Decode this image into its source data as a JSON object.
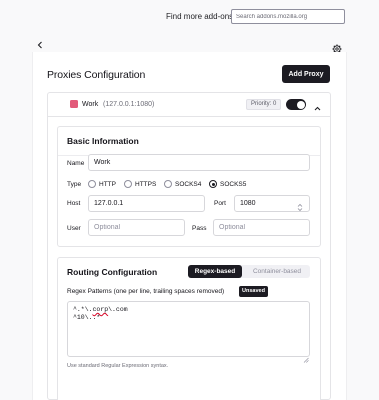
{
  "header": {
    "find_label": "Find more add-ons",
    "search_placeholder": "Search addons.mozilla.org"
  },
  "toolbar": {
    "back_icon": "chevron-left-icon",
    "settings_icon": "gear-icon"
  },
  "main": {
    "title": "Proxies Configuration",
    "add_proxy_label": "Add Proxy"
  },
  "proxy": {
    "color": "#e25a7a",
    "name": "Work",
    "address": "(127.0.0.1:1080)",
    "priority_label": "Priority: 0",
    "enabled": true
  },
  "basic": {
    "title": "Basic Information",
    "name_label": "Name",
    "name_value": "Work",
    "type_label": "Type",
    "types": [
      "HTTP",
      "HTTPS",
      "SOCKS4",
      "SOCKS5"
    ],
    "selected_type": "SOCKS5",
    "host_label": "Host",
    "host_value": "127.0.0.1",
    "port_label": "Port",
    "port_value": "1080",
    "user_label": "User",
    "user_placeholder": "Optional",
    "pass_label": "Pass",
    "pass_placeholder": "Optional"
  },
  "routing": {
    "title": "Routing Configuration",
    "mode_regex": "Regex-based",
    "mode_container": "Container-based",
    "active_mode": "Regex-based",
    "patterns_label": "Regex Patterns (one per line, trailing spaces removed)",
    "unsaved_badge": "Unsaved",
    "pattern_line_1_prefix": "^.*\\.",
    "pattern_line_1_word": "corp",
    "pattern_line_1_suffix": "\\.com",
    "pattern_line_2": "^10\\..*",
    "hint": "Use standard Regular Expression syntax."
  },
  "colors": {
    "accent_dark": "#1c1b22",
    "proxy_marker": "#e25a7a",
    "page_bg": "#f9f9fa"
  }
}
